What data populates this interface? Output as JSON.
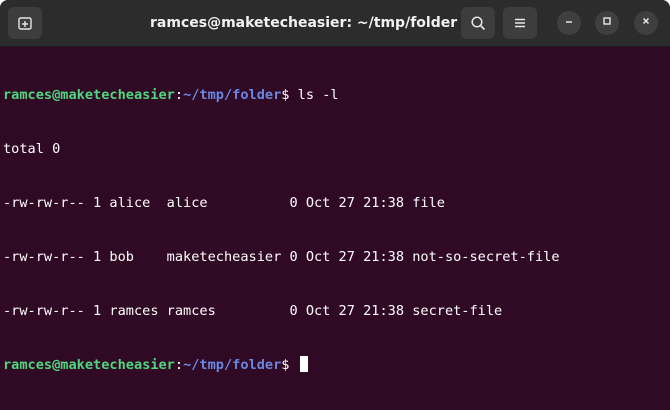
{
  "window": {
    "title": "ramces@maketecheasier: ~/tmp/folder"
  },
  "titlebar": {
    "new_tab_icon": "new-tab-icon",
    "search_icon": "search-icon",
    "menu_icon": "hamburger-menu-icon",
    "minimize_icon": "minimize-icon",
    "maximize_icon": "maximize-icon",
    "close_icon": "close-icon"
  },
  "terminal": {
    "prompt1": {
      "user": "ramces@maketecheasier",
      "colon": ":",
      "path": "~/tmp/folder",
      "symbol": "$ ",
      "command": "ls -l"
    },
    "output": [
      "total 0",
      "-rw-rw-r-- 1 alice  alice          0 Oct 27 21:38 file",
      "-rw-rw-r-- 1 bob    maketecheasier 0 Oct 27 21:38 not-so-secret-file",
      "-rw-rw-r-- 1 ramces ramces         0 Oct 27 21:38 secret-file"
    ],
    "prompt2": {
      "user": "ramces@maketecheasier",
      "colon": ":",
      "path": "~/tmp/folder",
      "symbol": "$ "
    }
  },
  "colors": {
    "terminal_bg": "#300a24",
    "titlebar_bg": "#2c2c2c",
    "prompt_user": "#4fd67e",
    "prompt_path": "#6a86e0",
    "text": "#ffffff"
  }
}
